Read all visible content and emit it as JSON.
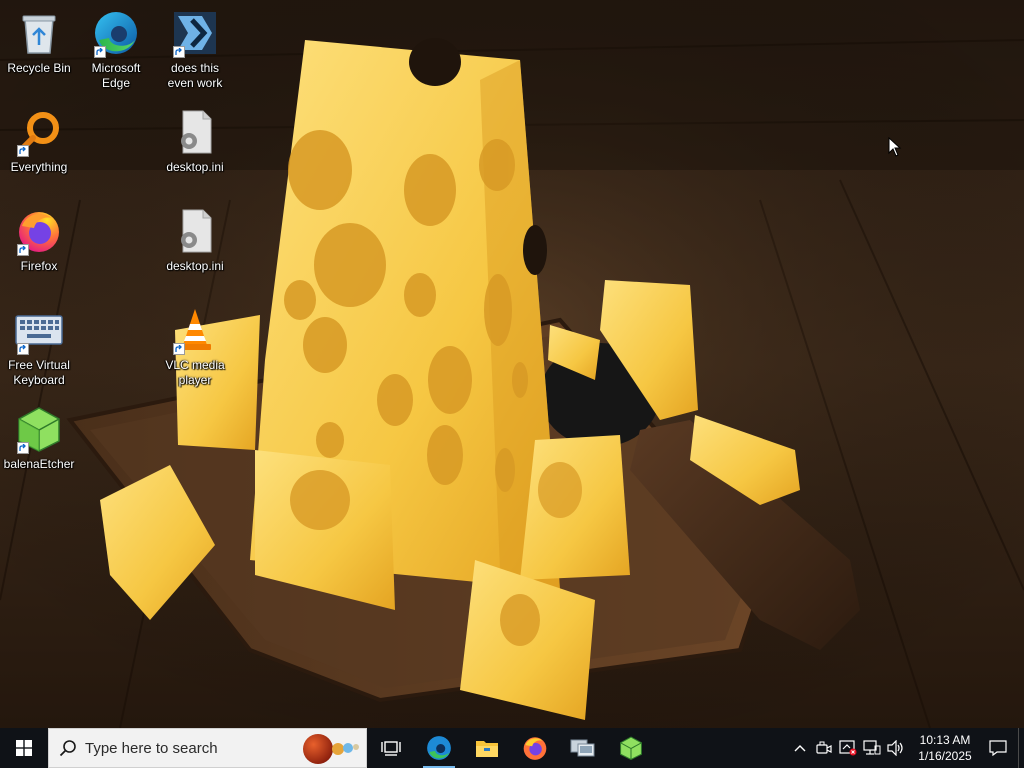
{
  "desktop": {
    "icons": [
      {
        "label": "Recycle Bin"
      },
      {
        "label": "Microsoft\nEdge"
      },
      {
        "label": "does this\neven work"
      },
      {
        "label": "Everything"
      },
      {
        "label": "desktop.ini"
      },
      {
        "label": "Firefox"
      },
      {
        "label": "desktop.ini"
      },
      {
        "label": "Free Virtual\nKeyboard"
      },
      {
        "label": "VLC media\nplayer"
      },
      {
        "label": "balenaEtcher"
      }
    ]
  },
  "taskbar": {
    "search_placeholder": "Type here to search",
    "pinned": [
      "task-view",
      "microsoft-edge",
      "file-explorer",
      "firefox",
      "remote-desktop",
      "balenaetcher"
    ],
    "accent_color": "#76b9ed"
  },
  "tray": {
    "time": "10:13 AM",
    "date": "1/16/2025"
  }
}
